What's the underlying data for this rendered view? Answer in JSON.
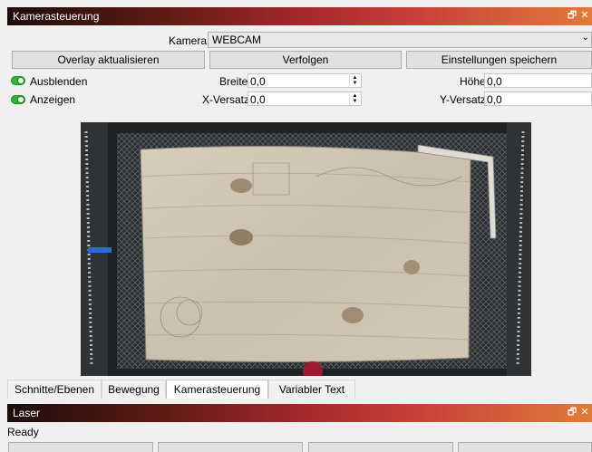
{
  "panel": {
    "title": "Kamerasteuerung",
    "float_icon": "float-icon",
    "close_icon": "close-icon"
  },
  "camera": {
    "label": "Kamera:",
    "value": "WEBCAM"
  },
  "buttons": {
    "update_overlay": "Overlay aktualisieren",
    "track": "Verfolgen",
    "save_settings": "Einstellungen speichern"
  },
  "toggles": {
    "hide": "Ausblenden",
    "show": "Anzeigen"
  },
  "fields": {
    "width": {
      "label": "Breite",
      "value": "0,0"
    },
    "height": {
      "label": "Höhe",
      "value": "0,0"
    },
    "x_offset": {
      "label": "X-Versatz",
      "value": "0,0"
    },
    "y_offset": {
      "label": "Y-Versatz",
      "value": "0,0"
    }
  },
  "tabs": [
    {
      "label": "Schnitte/Ebenen",
      "active": false
    },
    {
      "label": "Bewegung",
      "active": false
    },
    {
      "label": "Kamerasteuerung",
      "active": true
    },
    {
      "label": "Variabler Text",
      "active": false
    }
  ],
  "laser_panel": {
    "title": "Laser",
    "status": "Ready"
  },
  "colors": {
    "title_gradient_start": "#1c0d0a",
    "title_gradient_mid": "#a3282a",
    "title_gradient_end": "#e07a3a",
    "toggle_on": "#2fb52f"
  }
}
